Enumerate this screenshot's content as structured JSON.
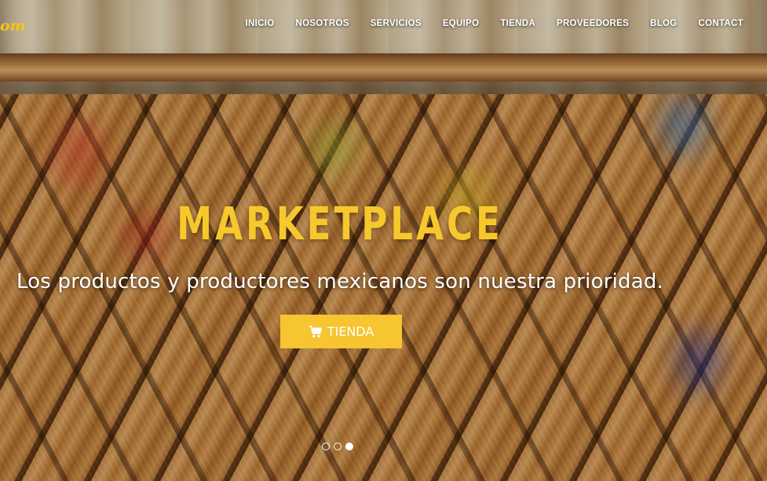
{
  "brand": {
    "logo_text": "om",
    "accent_color": "#f6c531",
    "headline_color": "#f6c82c"
  },
  "nav": {
    "items": [
      {
        "label": "INICIO"
      },
      {
        "label": "NOSOTROS"
      },
      {
        "label": "SERVICIOS"
      },
      {
        "label": "EQUIPO"
      },
      {
        "label": "TIENDA"
      },
      {
        "label": "PROVEEDORES"
      },
      {
        "label": "BLOG"
      },
      {
        "label": "CONTACT"
      }
    ]
  },
  "hero": {
    "headline": "MARKETPLACE",
    "subheadline": "Los productos y productores mexicanos son nuestra prioridad.",
    "cta": {
      "label": "TIENDA",
      "icon": "shopping-cart-icon"
    },
    "slider": {
      "slide_count": 3,
      "active_index": 2
    }
  }
}
